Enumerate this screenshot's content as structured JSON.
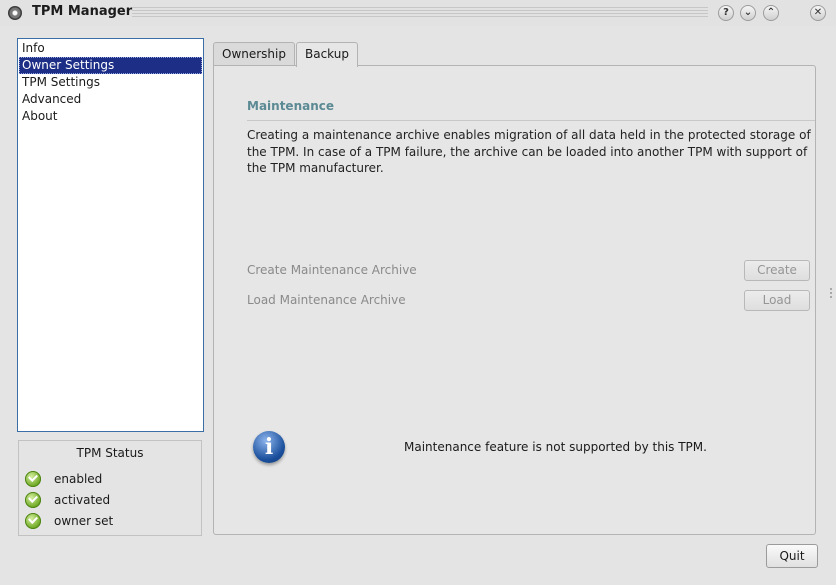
{
  "window": {
    "title": "TPM Manager",
    "buttons": [
      {
        "name": "help-icon",
        "glyph": "?"
      },
      {
        "name": "minimize-icon",
        "glyph": "⌄"
      },
      {
        "name": "maximize-icon",
        "glyph": "⌃"
      },
      {
        "name": "close-icon",
        "glyph": "✕"
      }
    ]
  },
  "sidebar": {
    "items": [
      {
        "label": "Info",
        "selected": false
      },
      {
        "label": "Owner Settings",
        "selected": true
      },
      {
        "label": "TPM Settings",
        "selected": false
      },
      {
        "label": "Advanced",
        "selected": false
      },
      {
        "label": "About",
        "selected": false
      }
    ]
  },
  "status": {
    "title": "TPM Status",
    "rows": [
      {
        "label": "enabled",
        "icon": "check-icon"
      },
      {
        "label": "activated",
        "icon": "check-icon"
      },
      {
        "label": "owner set",
        "icon": "check-icon"
      }
    ]
  },
  "tabs": [
    {
      "label": "Ownership",
      "active": false
    },
    {
      "label": "Backup",
      "active": true
    }
  ],
  "maintenance": {
    "title": "Maintenance",
    "description": "Creating a maintenance archive enables migration of all data held in the protected storage of the TPM. In case of a TPM failure, the archive can be loaded into another TPM with support of the TPM manufacturer.",
    "create_label": "Create Maintenance Archive",
    "create_button": "Create",
    "load_label": "Load Maintenance Archive",
    "load_button": "Load",
    "info_message": "Maintenance feature is not supported by this TPM."
  },
  "footer": {
    "quit_button": "Quit"
  },
  "colors": {
    "selection": "#1d2e86",
    "group_title": "#5b8a94",
    "disabled_text": "#8a8a8a"
  }
}
